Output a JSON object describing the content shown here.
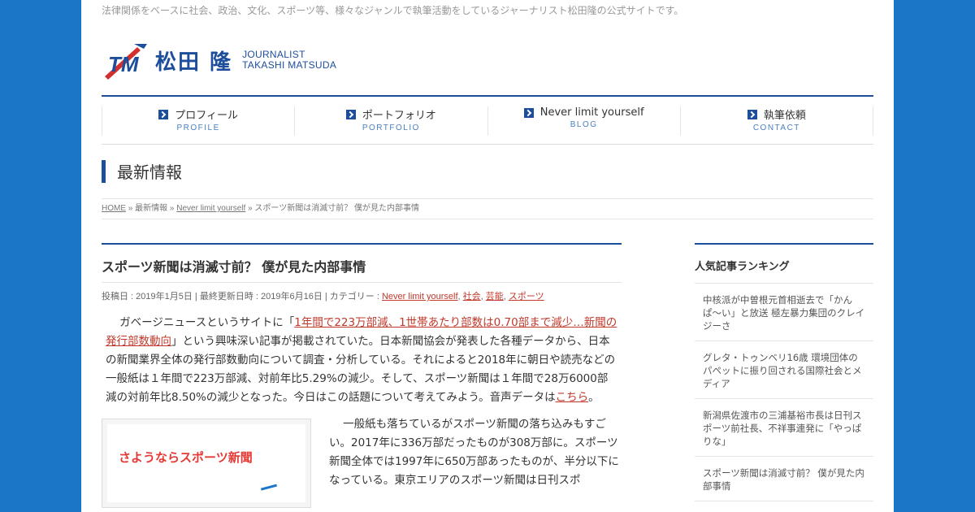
{
  "site": {
    "tagline": "法律関係をベースに社会、政治、文化、スポーツ等、様々なジャンルで執筆活動をしているジャーナリスト松田隆の公式サイトです。",
    "logo_name": "松田 隆",
    "logo_sub_1": "JOURNALIST",
    "logo_sub_2": "TAKASHI MATSUDA"
  },
  "nav": [
    {
      "label": "プロフィール",
      "sub": "PROFILE"
    },
    {
      "label": "ポートフォリオ",
      "sub": "PORTFOLIO"
    },
    {
      "label": "Never limit yourself",
      "sub": "BLOG"
    },
    {
      "label": "執筆依頼",
      "sub": "CONTACT"
    }
  ],
  "section_title": "最新情報",
  "breadcrumb": {
    "home": "HOME",
    "sep": "»",
    "cat1": "最新情報",
    "cat2": "Never limit yourself",
    "current": "スポーツ新聞は消滅寸前？ 僕が見た内部事情"
  },
  "article": {
    "title": "スポーツ新聞は消滅寸前？ 僕が見た内部事情",
    "meta_prefix": "投稿日 : 2019年1月5日 | 最終更新日時 : 2019年6月16日 | カテゴリー : ",
    "categories": [
      "Never limit yourself",
      "社会",
      "芸能",
      "スポーツ"
    ],
    "p1_before": "ガベージニュースというサイトに「",
    "p1_link": "1年間で223万部減、1世帯あたり部数は0.70部まで減少…新聞の発行部数動向",
    "p1_after": "」という興味深い記事が掲載されていた。日本新聞協会が発表した各種データから、日本の新聞業界全体の発行部数動向について調査・分析している。それによると2018年に朝日や読売などの一般紙は１年間で223万部減、対前年比5.29%の減少。そして、スポーツ新聞は１年間で28万6000部減の対前年比8.50%の減少となった。今日はこの話題について考えてみよう。音声データは",
    "p1_link2": "こちら",
    "p1_end": "。",
    "figure_text": "さようならスポーツ新聞",
    "p2": "一般紙も落ちているがスポーツ新聞の落ち込みもすごい。2017年に336万部だったものが308万部に。スポーツ新聞全体では1997年に650万部あったものが、半分以下になっている。東京エリアのスポーツ新聞は日刊スポ"
  },
  "sidebar": {
    "title": "人気記事ランキング",
    "items": [
      "中核派が中曽根元首相逝去で「かんぱ〜い」と放送 極左暴力集団のクレイジーさ",
      "グレタ・トゥンベリ16歳 環境団体のパペットに振り回される国際社会とメディア",
      "新潟県佐渡市の三浦基裕市長は日刊スポーツ前社長、不祥事連発に「やっぱりな」",
      "スポーツ新聞は消滅寸前？ 僕が見た内部事情"
    ]
  },
  "colors": {
    "background": "#1b76c8",
    "accent": "#1d4e9b",
    "link": "#c0392b"
  }
}
